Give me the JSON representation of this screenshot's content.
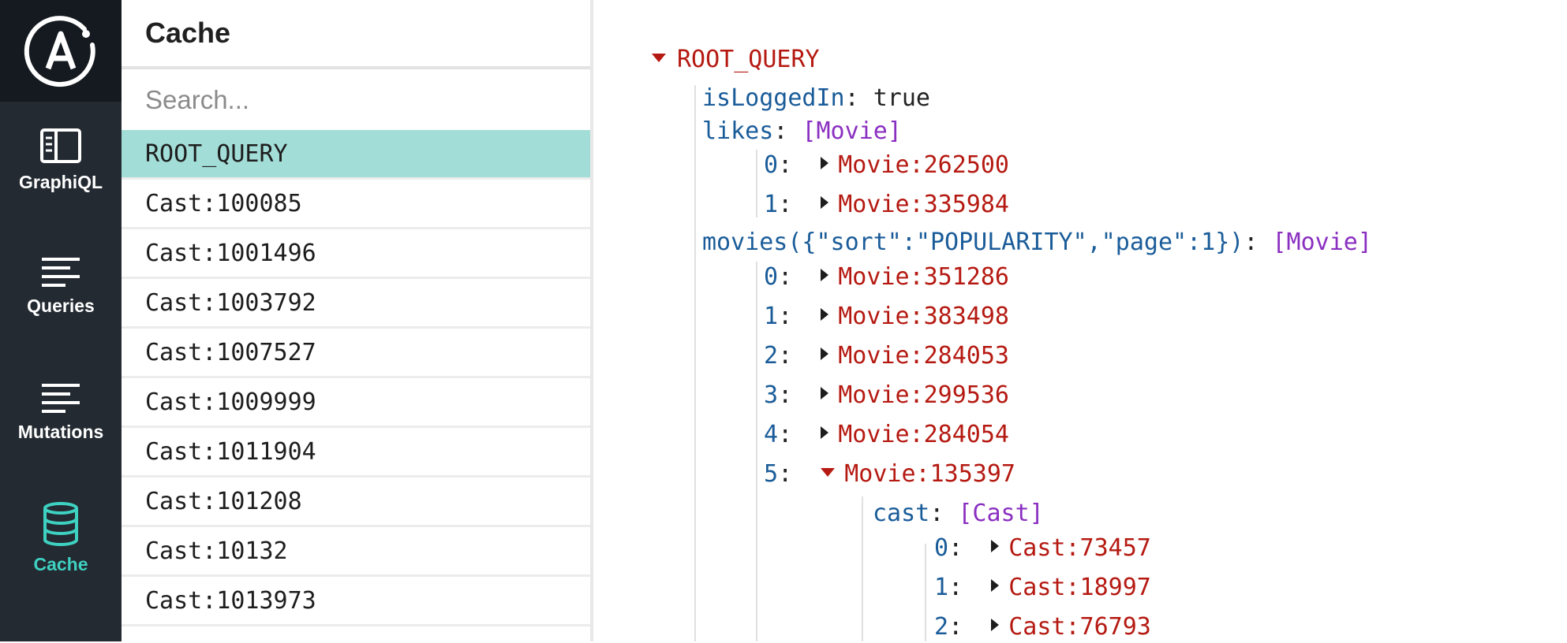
{
  "rail": {
    "items": [
      {
        "label": "GraphiQL",
        "icon": "graphiql-icon"
      },
      {
        "label": "Queries",
        "icon": "queries-icon"
      },
      {
        "label": "Mutations",
        "icon": "mutations-icon"
      },
      {
        "label": "Cache",
        "icon": "database-icon",
        "active": true
      }
    ],
    "accent": "#3ed1c1"
  },
  "panel": {
    "title": "Cache",
    "search_placeholder": "Search...",
    "items": [
      "ROOT_QUERY",
      "Cast:100085",
      "Cast:1001496",
      "Cast:1003792",
      "Cast:1007527",
      "Cast:1009999",
      "Cast:1011904",
      "Cast:101208",
      "Cast:10132",
      "Cast:1013973"
    ],
    "selected": "ROOT_QUERY"
  },
  "tree": {
    "root": "ROOT_QUERY",
    "isLoggedIn_key": "isLoggedIn",
    "isLoggedIn_value": "true",
    "likes_key": "likes",
    "likes_type": "[Movie]",
    "likes": [
      {
        "index": "0",
        "ref": "Movie:262500"
      },
      {
        "index": "1",
        "ref": "Movie:335984"
      }
    ],
    "movies_key": "movies({\"sort\":\"POPULARITY\",\"page\":1})",
    "movies_type": "[Movie]",
    "movies": [
      {
        "index": "0",
        "ref": "Movie:351286"
      },
      {
        "index": "1",
        "ref": "Movie:383498"
      },
      {
        "index": "2",
        "ref": "Movie:284053"
      },
      {
        "index": "3",
        "ref": "Movie:299536"
      },
      {
        "index": "4",
        "ref": "Movie:284054"
      },
      {
        "index": "5",
        "ref": "Movie:135397"
      }
    ],
    "cast_key": "cast",
    "cast_type": "[Cast]",
    "cast": [
      {
        "index": "0",
        "ref": "Cast:73457"
      },
      {
        "index": "1",
        "ref": "Cast:18997"
      },
      {
        "index": "2",
        "ref": "Cast:76793"
      }
    ]
  },
  "colors": {
    "rail_bg": "#232a31",
    "selected_row": "#a3ddd7",
    "key": "#1a5c99",
    "reference": "#b51a12",
    "type": "#8a2fc0"
  }
}
